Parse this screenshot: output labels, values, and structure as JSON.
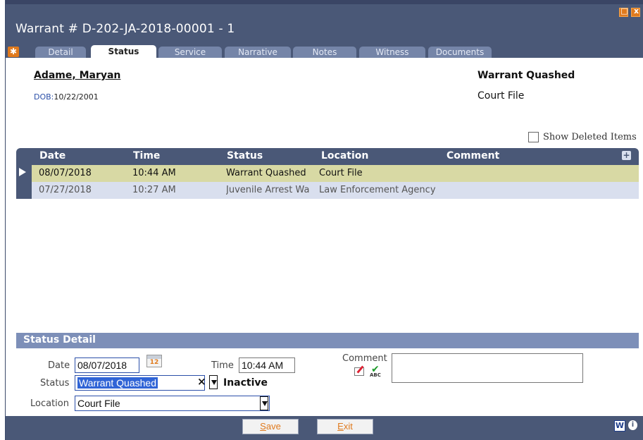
{
  "window": {
    "title": "Warrant # D-202-JA-2018-00001 - 1",
    "restore_glyph": "□",
    "close_glyph": "x"
  },
  "tabs": [
    {
      "label": "Detail",
      "active": false
    },
    {
      "label": "Status",
      "active": true
    },
    {
      "label": "Service",
      "active": false
    },
    {
      "label": "Narrative",
      "active": false
    },
    {
      "label": "Notes",
      "active": false
    },
    {
      "label": "Witness",
      "active": false
    },
    {
      "label": "Documents",
      "active": false
    }
  ],
  "person": {
    "name": "Adame, Maryan",
    "dob_label": "DOB:",
    "dob_value": "10/22/2001"
  },
  "summary": {
    "status": "Warrant Quashed",
    "location": "Court File"
  },
  "show_deleted_label": "Show Deleted Items",
  "grid": {
    "columns": [
      "Date",
      "Time",
      "Status",
      "Location",
      "Comment"
    ],
    "rows": [
      {
        "date": "08/07/2018",
        "time": "10:44 AM",
        "status": "Warrant Quashed",
        "location": "Court File",
        "comment": ""
      },
      {
        "date": "07/27/2018",
        "time": "10:27 AM",
        "status": "Juvenile Arrest Wa",
        "location": "Law Enforcement Agency",
        "comment": ""
      }
    ]
  },
  "detail": {
    "title": "Status Detail",
    "date_label": "Date",
    "date_value": "08/07/2018",
    "calendar_day": "12",
    "time_label": "Time",
    "time_value": "10:44 AM",
    "status_label": "Status",
    "status_value": "Warrant Quashed",
    "status_state": "Inactive",
    "location_label": "Location",
    "location_value": "Court File",
    "comment_label": "Comment",
    "comment_value": "",
    "clear_glyph": "×",
    "spell_text": "ABC"
  },
  "footer": {
    "save_first": "S",
    "save_rest": "ave",
    "exit_first": "E",
    "exit_rest": "xit",
    "word_glyph": "W",
    "info_glyph": "i"
  },
  "colors": {
    "chrome": "#4a5877",
    "accent": "#e07a1d",
    "selected_row": "#d8d9a4",
    "alt_row": "#d9dfee",
    "detail_header": "#7d8fb8"
  }
}
